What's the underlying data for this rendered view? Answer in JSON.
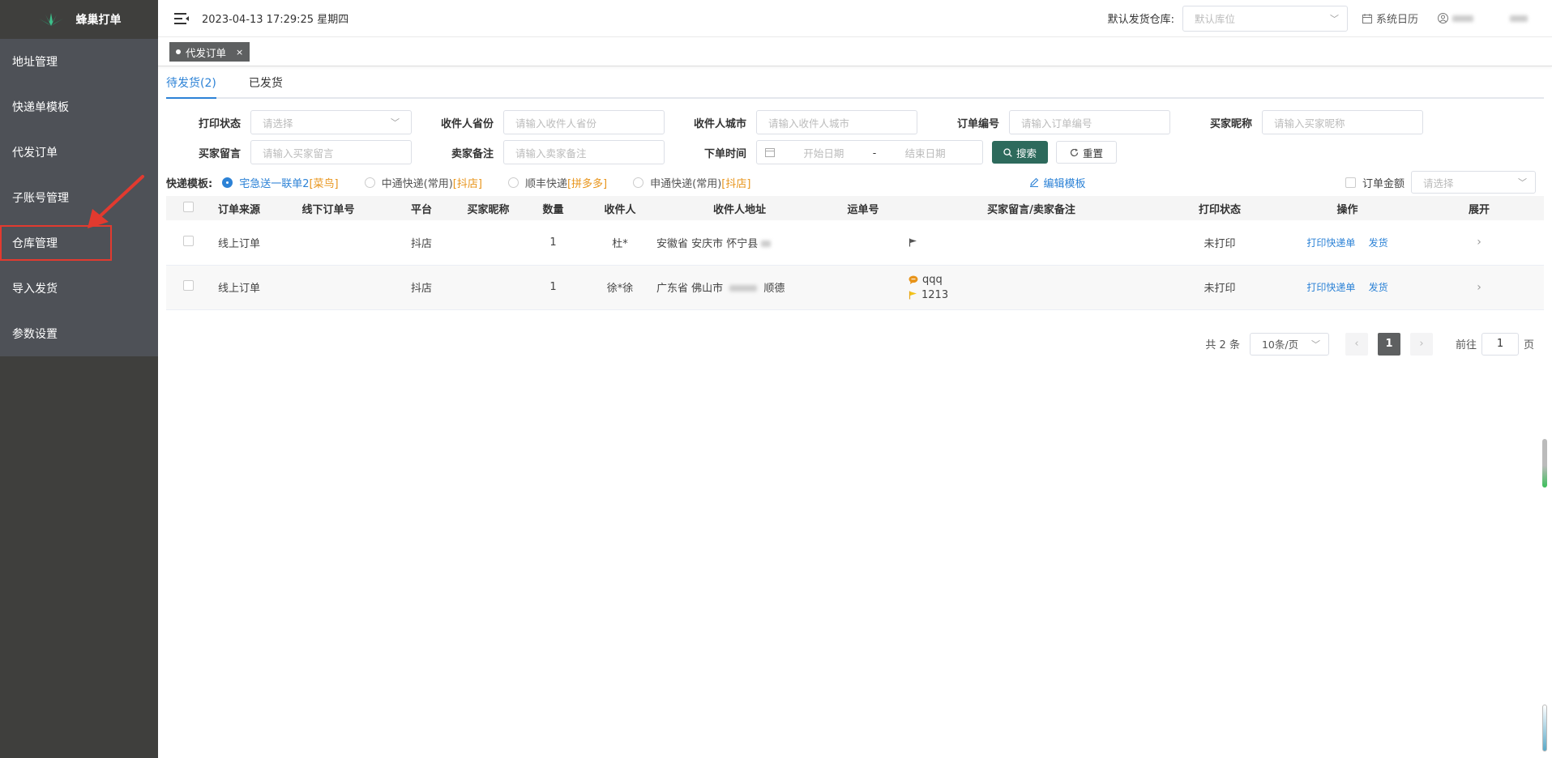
{
  "app": {
    "name": "蜂巢打单"
  },
  "sidebar": {
    "items": [
      {
        "label": "地址管理"
      },
      {
        "label": "快递单模板"
      },
      {
        "label": "代发订单"
      },
      {
        "label": "子账号管理"
      },
      {
        "label": "仓库管理"
      },
      {
        "label": "导入发货"
      },
      {
        "label": "参数设置"
      }
    ]
  },
  "header": {
    "datetime": "2023-04-13 17:29:25 星期四",
    "warehouse_label": "默认发货仓库:",
    "warehouse_placeholder": "默认库位",
    "calendar_label": "系统日历"
  },
  "tagbar": {
    "tag_label": "代发订单",
    "close": "×"
  },
  "tabs": [
    {
      "label": "待发货(2)"
    },
    {
      "label": "已发货"
    }
  ],
  "filters": {
    "print_status_label": "打印状态",
    "print_status_placeholder": "请选择",
    "province_label": "收件人省份",
    "province_placeholder": "请输入收件人省份",
    "city_label": "收件人城市",
    "city_placeholder": "请输入收件人城市",
    "order_no_label": "订单编号",
    "order_no_placeholder": "请输入订单编号",
    "nickname_label": "买家昵称",
    "nickname_placeholder": "请输入买家昵称",
    "buyer_msg_label": "买家留言",
    "buyer_msg_placeholder": "请输入买家留言",
    "seller_note_label": "卖家备注",
    "seller_note_placeholder": "请输入卖家备注",
    "order_time_label": "下单时间",
    "start_date": "开始日期",
    "date_sep": "-",
    "end_date": "结束日期",
    "search_button": "搜索",
    "reset_button": "重置"
  },
  "templates": {
    "label": "快递模板:",
    "options": [
      {
        "name": "宅急送一联单2",
        "platform": "[菜鸟]",
        "checked": true
      },
      {
        "name": "中通快递(常用)",
        "platform": "[抖店]",
        "checked": false
      },
      {
        "name": "顺丰快递",
        "platform": "[拼多多]",
        "checked": false
      },
      {
        "name": "申通快递(常用)",
        "platform": "[抖店]",
        "checked": false
      }
    ],
    "edit_label": "编辑模板",
    "amount_label": "订单金额",
    "amount_placeholder": "请选择"
  },
  "table": {
    "headers": [
      "订单来源",
      "线下订单号",
      "平台",
      "买家昵称",
      "数量",
      "收件人",
      "收件人地址",
      "运单号",
      "买家留言/卖家备注",
      "打印状态",
      "操作",
      "展开"
    ],
    "rows": [
      {
        "source": "线上订单",
        "offline_no": "",
        "platform": "抖店",
        "nickname": "",
        "qty": "1",
        "recipient": "杜*",
        "address": "安徽省 安庆市 怀宁县",
        "waybill": "",
        "buyer_msg": "",
        "seller_note": "",
        "print_status": "未打印",
        "op_print": "打印快递单",
        "op_ship": "发货"
      },
      {
        "source": "线上订单",
        "offline_no": "",
        "platform": "抖店",
        "nickname": "",
        "qty": "1",
        "recipient": "徐*徐",
        "address": "广东省 佛山市",
        "address_tail": "顺德",
        "waybill": "",
        "buyer_msg": "qqq",
        "seller_note": "1213",
        "print_status": "未打印",
        "op_print": "打印快递单",
        "op_ship": "发货"
      }
    ]
  },
  "pagination": {
    "total": "共 2 条",
    "page_size": "10条/页",
    "current": "1",
    "goto_label": "前往",
    "goto_value": "1",
    "page_unit": "页"
  },
  "colors": {
    "sidebar": "#3f3f3d",
    "menu": "#4e5157",
    "accent": "#2c82d6",
    "search_btn": "#2d6a5c",
    "tag": "#5e6061",
    "highlight": "#e23a2f",
    "orange": "#e8941a"
  }
}
